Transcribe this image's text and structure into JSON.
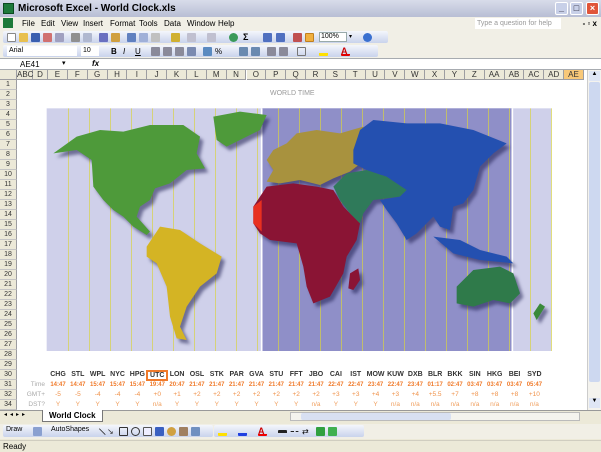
{
  "window": {
    "title": "Microsoft Excel - World Clock.xls"
  },
  "menu": {
    "items": [
      "File",
      "Edit",
      "View",
      "Insert",
      "Format",
      "Tools",
      "Data",
      "Window",
      "Help"
    ],
    "help_placeholder": "Type a question for help"
  },
  "toolbar": {
    "zoom": "100%",
    "font": "Arial",
    "font_size": "10"
  },
  "formula_bar": {
    "name_box": "AE41",
    "fx": "fx"
  },
  "columns": [
    "ABC",
    "D",
    "E",
    "F",
    "G",
    "H",
    "I",
    "J",
    "K",
    "L",
    "M",
    "N",
    "O",
    "P",
    "Q",
    "R",
    "S",
    "T",
    "U",
    "V",
    "W",
    "X",
    "Y",
    "Z",
    "AA",
    "AB",
    "AC",
    "AD",
    "AE"
  ],
  "selected_column": "AE",
  "rows": [
    "1",
    "2",
    "3",
    "4",
    "5",
    "6",
    "7",
    "8",
    "9",
    "10",
    "11",
    "12",
    "13",
    "14",
    "15",
    "16",
    "17",
    "18",
    "19",
    "20",
    "21",
    "22",
    "23",
    "24",
    "25",
    "26",
    "27",
    "28",
    "29",
    "30",
    "31",
    "32",
    "34"
  ],
  "sheet": {
    "title": "WORLD TIME",
    "row_labels": {
      "time": "Time",
      "gmt": "GMT+",
      "dst": "DST?"
    },
    "highlighted_city": "UTC",
    "cities": [
      {
        "code": "CHG",
        "time": "14:47",
        "gmt": "-5",
        "dst": "Y"
      },
      {
        "code": "STL",
        "time": "14:47",
        "gmt": "-5",
        "dst": "Y"
      },
      {
        "code": "WPL",
        "time": "15:47",
        "gmt": "-4",
        "dst": "Y"
      },
      {
        "code": "NYC",
        "time": "15:47",
        "gmt": "-4",
        "dst": "Y"
      },
      {
        "code": "HPG",
        "time": "15:47",
        "gmt": "-4",
        "dst": "Y"
      },
      {
        "code": "UTC",
        "time": "19:47",
        "gmt": "+0",
        "dst": "n/a"
      },
      {
        "code": "LON",
        "time": "20:47",
        "gmt": "+1",
        "dst": "Y"
      },
      {
        "code": "OSL",
        "time": "21:47",
        "gmt": "+2",
        "dst": "Y"
      },
      {
        "code": "STK",
        "time": "21:47",
        "gmt": "+2",
        "dst": "Y"
      },
      {
        "code": "PAR",
        "time": "21:47",
        "gmt": "+2",
        "dst": "Y"
      },
      {
        "code": "GVA",
        "time": "21:47",
        "gmt": "+2",
        "dst": "Y"
      },
      {
        "code": "STU",
        "time": "21:47",
        "gmt": "+2",
        "dst": "Y"
      },
      {
        "code": "FFT",
        "time": "21:47",
        "gmt": "+2",
        "dst": "Y"
      },
      {
        "code": "JBO",
        "time": "21:47",
        "gmt": "+2",
        "dst": "n/a"
      },
      {
        "code": "CAI",
        "time": "22:47",
        "gmt": "+3",
        "dst": "Y"
      },
      {
        "code": "IST",
        "time": "22:47",
        "gmt": "+3",
        "dst": "Y"
      },
      {
        "code": "MOW",
        "time": "23:47",
        "gmt": "+4",
        "dst": "Y"
      },
      {
        "code": "KUW",
        "time": "22:47",
        "gmt": "+3",
        "dst": "n/a"
      },
      {
        "code": "DXB",
        "time": "23:47",
        "gmt": "+4",
        "dst": "n/a"
      },
      {
        "code": "BLR",
        "time": "01:17",
        "gmt": "+5.5",
        "dst": "n/a"
      },
      {
        "code": "BKK",
        "time": "02:47",
        "gmt": "+7",
        "dst": "n/a"
      },
      {
        "code": "SIN",
        "time": "03:47",
        "gmt": "+8",
        "dst": "n/a"
      },
      {
        "code": "HKG",
        "time": "03:47",
        "gmt": "+8",
        "dst": "n/a"
      },
      {
        "code": "BEI",
        "time": "03:47",
        "gmt": "+8",
        "dst": "n/a"
      },
      {
        "code": "SYD",
        "time": "05:47",
        "gmt": "+10",
        "dst": "n/a"
      }
    ]
  },
  "tabs": {
    "active": "World Clock"
  },
  "draw_toolbar": {
    "draw": "Draw",
    "autoshapes": "AutoShapes"
  },
  "status": {
    "text": "Ready"
  },
  "colors": {
    "accent": "#f07a2a",
    "night": "#8f8fc8",
    "day": "#cfd0ea"
  }
}
